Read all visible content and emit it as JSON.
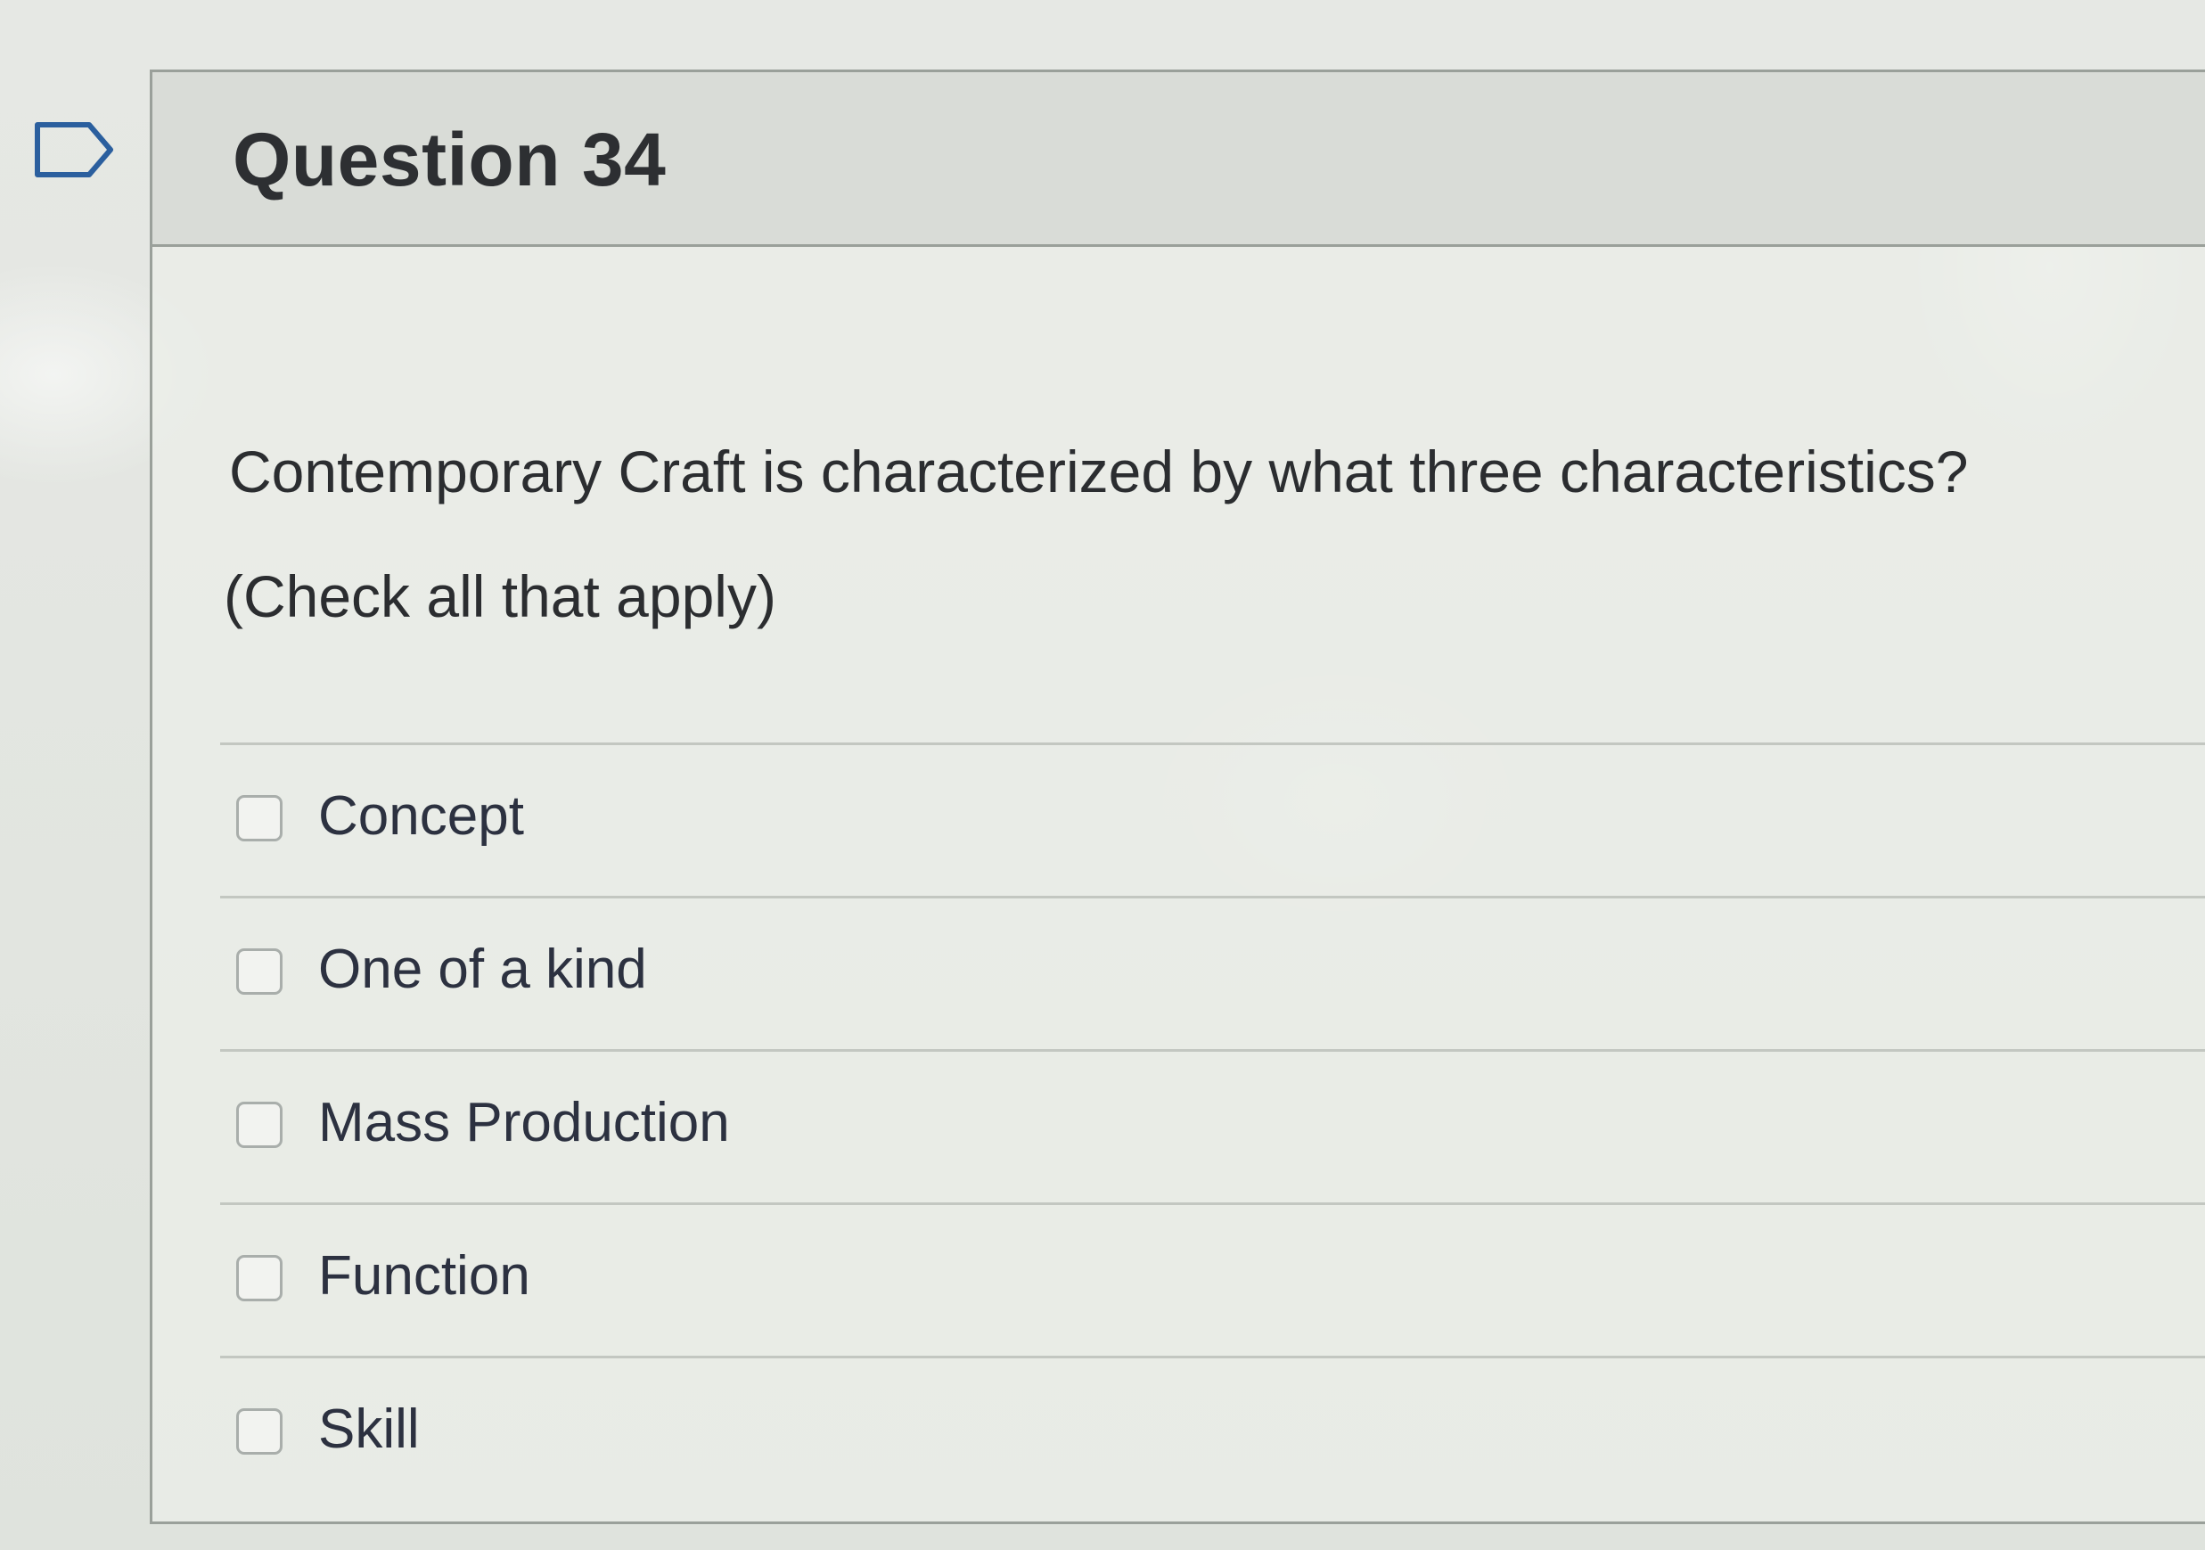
{
  "question": {
    "title": "Question 34",
    "text": "Contemporary Craft is characterized by what three characteristics?",
    "hint": "(Check all that apply)",
    "flag_icon": "flag-outline-icon"
  },
  "answers": [
    {
      "label": "Concept",
      "checked": false
    },
    {
      "label": "One of a kind",
      "checked": false
    },
    {
      "label": "Mass Production",
      "checked": false
    },
    {
      "label": "Function",
      "checked": false
    },
    {
      "label": "Skill",
      "checked": false
    }
  ],
  "colors": {
    "border": "#9aa09a",
    "header_background": "#d9dcd7",
    "text": "#2b2d30",
    "checkbox_border": "#a9aeab"
  }
}
